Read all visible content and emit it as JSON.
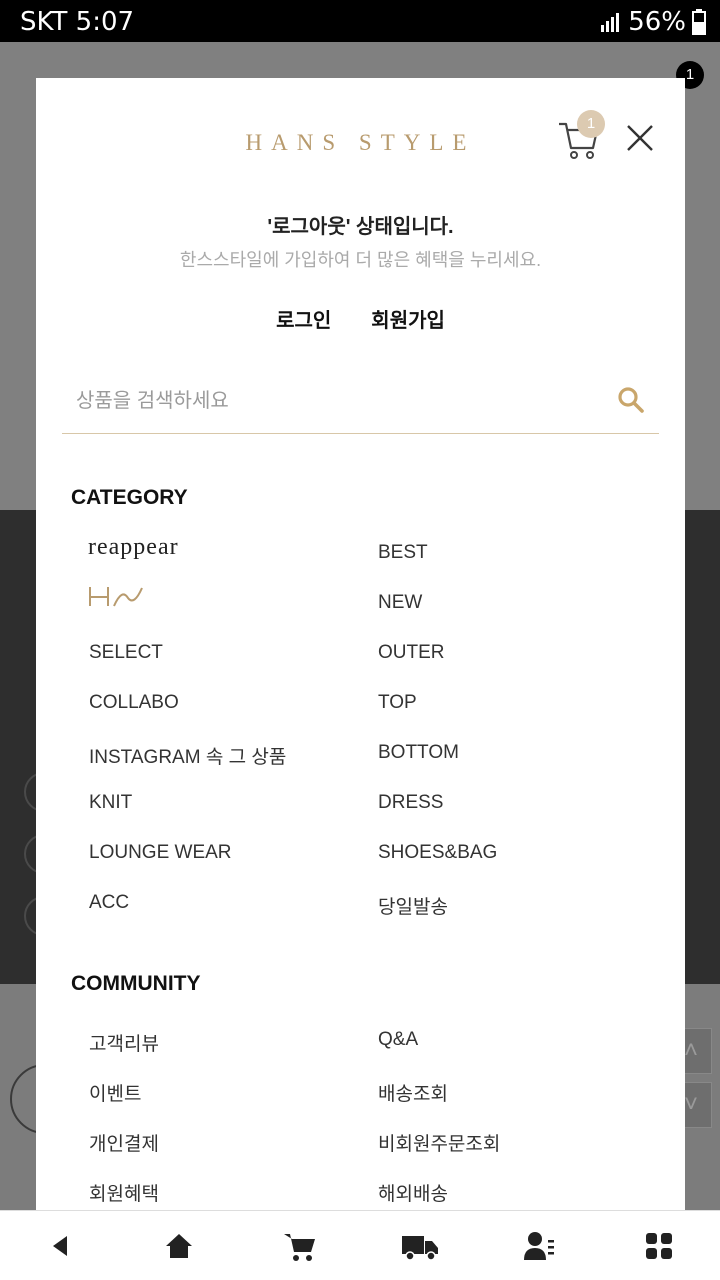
{
  "status_bar": {
    "carrier_time": "SKT 5:07",
    "battery": "56%"
  },
  "background": {
    "cart_badge": "1"
  },
  "modal": {
    "logo": "HANS STYLE",
    "cart_count": "1",
    "login_status_title": "'로그아웃' 상태입니다.",
    "login_status_sub": "한스스타일에 가입하여 더 많은 혜택을 누리세요.",
    "login_label": "로그인",
    "signup_label": "회원가입",
    "search_placeholder": "상품을 검색하세요",
    "category_title": "CATEGORY",
    "category_left": [
      {
        "label": "reappear"
      },
      {
        "label": "HS"
      },
      {
        "label": "SELECT"
      },
      {
        "label": "COLLABO"
      },
      {
        "label": "INSTAGRAM 속 그 상품"
      },
      {
        "label": "KNIT"
      },
      {
        "label": "LOUNGE WEAR"
      },
      {
        "label": "ACC"
      }
    ],
    "category_right": [
      {
        "label": "BEST"
      },
      {
        "label": "NEW"
      },
      {
        "label": "OUTER"
      },
      {
        "label": "TOP"
      },
      {
        "label": "BOTTOM"
      },
      {
        "label": "DRESS"
      },
      {
        "label": "SHOES&BAG"
      },
      {
        "label": "당일발송"
      }
    ],
    "community_title": "COMMUNITY",
    "community_left": [
      {
        "label": "고객리뷰"
      },
      {
        "label": "이벤트"
      },
      {
        "label": "개인결제"
      },
      {
        "label": "회원혜택"
      }
    ],
    "community_right": [
      {
        "label": "Q&A"
      },
      {
        "label": "배송조회"
      },
      {
        "label": "비회원주문조회"
      },
      {
        "label": "해외배송"
      }
    ]
  },
  "bottom_nav": {
    "icons": [
      "back-icon",
      "home-icon",
      "cart-icon",
      "delivery-truck-icon",
      "my-page-icon",
      "menu-grid-icon"
    ]
  },
  "colors": {
    "accent": "#b89b6e",
    "badge": "#dccab1",
    "text": "#333333"
  }
}
